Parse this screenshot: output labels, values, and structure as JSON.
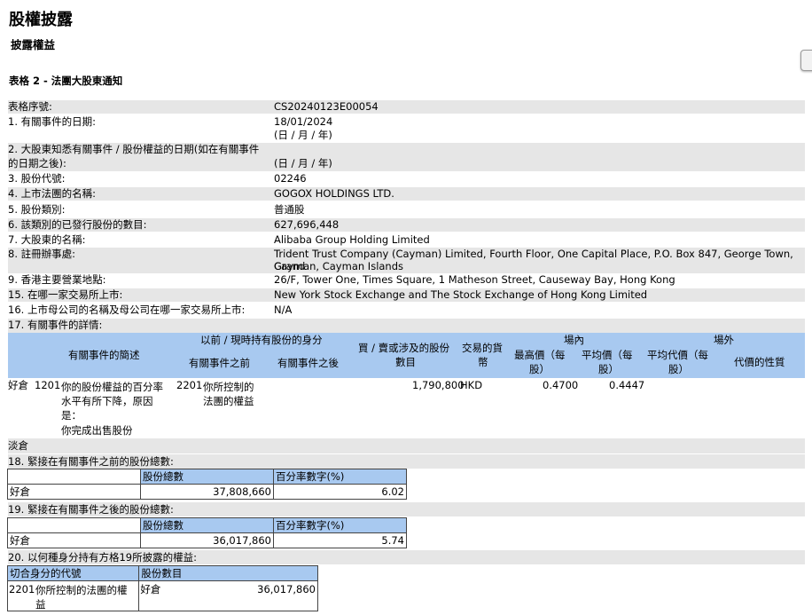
{
  "page": {
    "title": "股權披露",
    "subtitle": "披露權益",
    "form_title": "表格 2 - 法團大股東通知"
  },
  "colors": {
    "header_blue": "#a8c9f0",
    "row_gray": "#e6e6e6"
  },
  "fields": {
    "serial_label": "表格序號:",
    "serial_value": "CS20240123E00054",
    "f1_label": "1. 有關事件的日期:",
    "f1_value": "18/01/2024",
    "f1_fmt": "(日 / 月 / 年)",
    "f2_label_1": "2. 大股東知悉有關事件 / 股份權益的日期(如在有關事件",
    "f2_label_2": "的日期之後):",
    "f2_fmt": "(日 / 月 / 年)",
    "f3_label": "3. 股份代號:",
    "f3_value": "02246",
    "f4_label": "4. 上市法團的名稱:",
    "f4_value": "GOGOX HOLDINGS LTD.",
    "f5_label": "5. 股份類別:",
    "f5_value": "普通股",
    "f6_label": "6. 該類別的已發行股份的數目:",
    "f6_value": "627,696,448",
    "f7_label": "7. 大股東的名稱:",
    "f7_value": "Alibaba Group Holding Limited",
    "f8_label": "8. 註冊辦事處:",
    "f8_value_1": "Trident Trust Company (Cayman) Limited, Fourth Floor, One Capital Place, P.O. Box 847, George Town, Grand",
    "f8_value_2": "Cayman, Cayman Islands",
    "f9_label": "9. 香港主要營業地點:",
    "f9_value": "26/F, Tower One, Times Square, 1 Matheson Street, Causeway Bay, Hong Kong",
    "f15_label": "15. 在哪一家交易所上市:",
    "f15_value": "New York Stock Exchange and The Stock Exchange of Hong Kong Limited",
    "f16_label": "16. 上市母公司的名稱及母公司在哪一家交易所上市:",
    "f16_value": "N/A",
    "f17_label": "17. 有關事件的詳情:"
  },
  "event_table": {
    "headers": {
      "event_code": "有關事件的簡述",
      "capacity_group": "以前 / 現時持有股份的身分",
      "before": "有關事件之前",
      "after": "有關事件之後",
      "shares_1": "買 / 賣或涉及的股份",
      "shares_2": "數目",
      "currency_1": "交易的貨",
      "currency_2": "幣",
      "onex_group": "場內",
      "high_1": "最高價（每",
      "high_2": "股）",
      "avg_1": "平均價（每",
      "avg_2": "股）",
      "offex_group": "場外",
      "offavg_1": "平均代價（每",
      "offavg_2": "股）",
      "nature": "代價的性質"
    },
    "row": {
      "position": "好倉",
      "code": "1201",
      "desc_1": "你的股份權益的百分率",
      "desc_2": "水平有所下降，原因",
      "desc_3": "是：",
      "desc_4": "你完成出售股份",
      "cap_code": "2201",
      "cap_desc_1": "你所控制的",
      "cap_desc_2": "法團的權益",
      "shares": "1,790,800",
      "currency": "HKD",
      "high": "0.4700",
      "avg": "0.4447"
    },
    "footer_label": "淡倉"
  },
  "sec18": {
    "label": "18. 緊接在有關事件之前的股份總數:",
    "col_shares": "股份總數",
    "col_pct": "百分率數字(%)",
    "row_label": "好倉",
    "shares": "37,808,660",
    "pct": "6.02"
  },
  "sec19": {
    "label": "19. 緊接在有關事件之後的股份總數:",
    "col_shares": "股份總數",
    "col_pct": "百分率數字(%)",
    "row_label": "好倉",
    "shares": "36,017,860",
    "pct": "5.74"
  },
  "sec20": {
    "label": "20. 以何種身分持有方格19所披露的權益:",
    "col_code": "切合身分的代號",
    "col_shares": "股份數目",
    "code": "2201",
    "desc_1": "你所控制的法團的權",
    "desc_2": "益",
    "position": "好倉",
    "shares": "36,017,860"
  }
}
